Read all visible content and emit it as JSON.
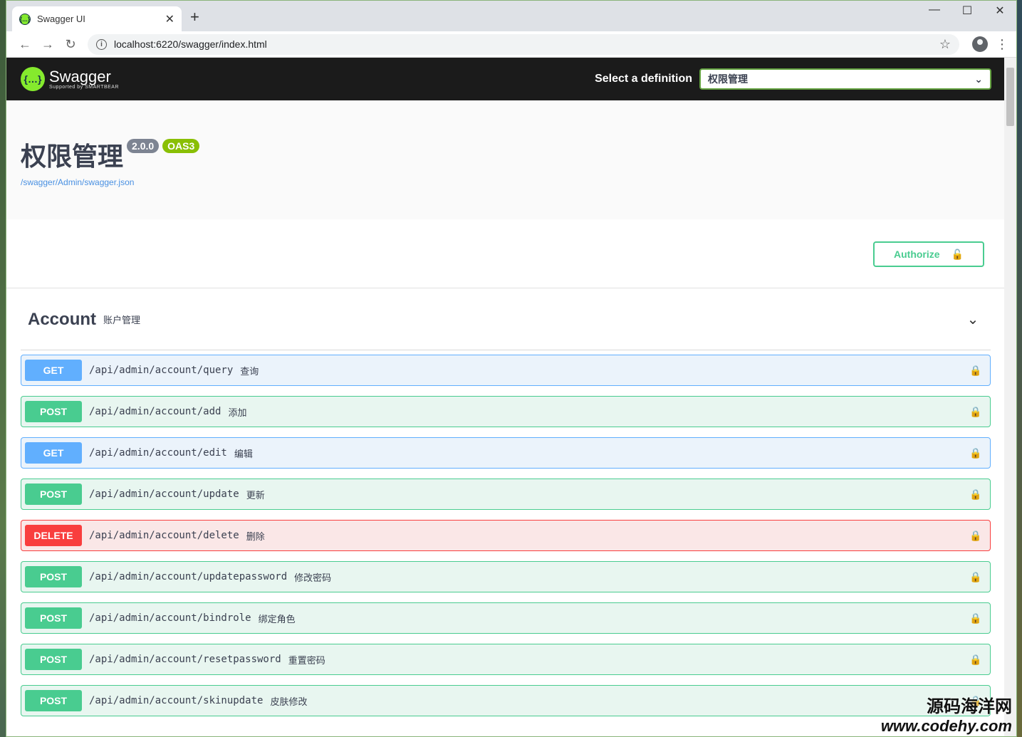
{
  "browser": {
    "tab_title": "Swagger UI",
    "tab_favicon": "{...}",
    "url": "localhost:6220/swagger/index.html",
    "icons": {
      "back": "←",
      "forward": "→",
      "reload": "↻",
      "star": "☆",
      "menu": "⋮",
      "close_tab": "✕",
      "new_tab": "+",
      "minimize": "—",
      "maximize": "☐",
      "close": "✕",
      "info": "i"
    }
  },
  "topbar": {
    "logo_mark": "{…}",
    "logo_name": "Swagger",
    "logo_sub": "Supported by SMARTBEAR",
    "definition_label": "Select a definition",
    "definition_value": "权限管理",
    "dropdown_icon": "⌄"
  },
  "info": {
    "title": "权限管理",
    "version": "2.0.0",
    "oas": "OAS3",
    "spec_url": "/swagger/Admin/swagger.json"
  },
  "auth": {
    "button_label": "Authorize",
    "lock_icon": "🔓"
  },
  "tag": {
    "name": "Account",
    "description": "账户管理",
    "chevron": "⌄",
    "operations": [
      {
        "method": "GET",
        "path": "/api/admin/account/query",
        "summary": "查询"
      },
      {
        "method": "POST",
        "path": "/api/admin/account/add",
        "summary": "添加"
      },
      {
        "method": "GET",
        "path": "/api/admin/account/edit",
        "summary": "编辑"
      },
      {
        "method": "POST",
        "path": "/api/admin/account/update",
        "summary": "更新"
      },
      {
        "method": "DELETE",
        "path": "/api/admin/account/delete",
        "summary": "删除"
      },
      {
        "method": "POST",
        "path": "/api/admin/account/updatepassword",
        "summary": "修改密码"
      },
      {
        "method": "POST",
        "path": "/api/admin/account/bindrole",
        "summary": "绑定角色"
      },
      {
        "method": "POST",
        "path": "/api/admin/account/resetpassword",
        "summary": "重置密码"
      },
      {
        "method": "POST",
        "path": "/api/admin/account/skinupdate",
        "summary": "皮肤修改"
      }
    ],
    "op_lock_icon": "🔒"
  },
  "watermark": {
    "line1": "源码海洋网",
    "line2": "www.codehy.com"
  },
  "colors": {
    "get": "#61affe",
    "post": "#49cc90",
    "delete": "#f93e3e",
    "brand": "#85ea2d"
  }
}
